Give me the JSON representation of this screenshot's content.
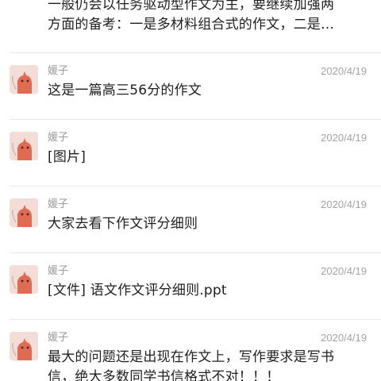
{
  "top_message": {
    "lines": [
      "一般仍会以任务驱动型作文为主，要继续加强两",
      "方面的备考：一是多材料组合式的作文，二是…"
    ]
  },
  "messages": [
    {
      "sender": "媛子",
      "date": "2020/4/19",
      "lines": [
        "这是一篇高三56分的作文"
      ],
      "avatar_icon": "cartoon-cat-avatar"
    },
    {
      "sender": "媛子",
      "date": "2020/4/19",
      "lines": [
        "[图片]"
      ],
      "avatar_icon": "cartoon-cat-avatar"
    },
    {
      "sender": "媛子",
      "date": "2020/4/19",
      "lines": [
        "大家去看下作文评分细则"
      ],
      "avatar_icon": "cartoon-cat-avatar"
    },
    {
      "sender": "媛子",
      "date": "2020/4/19",
      "lines": [
        "[文件] 语文作文评分细则.ppt"
      ],
      "avatar_icon": "cartoon-cat-avatar"
    },
    {
      "sender": "媛子",
      "date": "2020/4/19",
      "lines": [
        "最大的问题还是出现在作文上，写作要求是写书",
        "信，绝大多数同学书信格式不对！！！"
      ],
      "avatar_icon": "cartoon-cat-avatar"
    }
  ],
  "colors": {
    "text": "#1f1f1f",
    "meta": "#9a9a9a",
    "divider": "#e8e8e8",
    "avatar_bg": "#f4dcd7",
    "avatar_accent": "#e06a52"
  }
}
